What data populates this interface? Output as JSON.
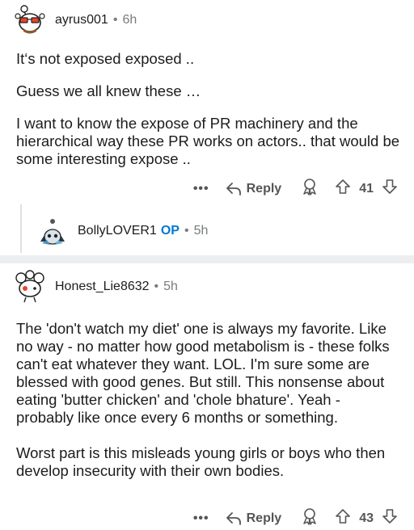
{
  "comments": [
    {
      "username": "ayrus001",
      "time": "6h",
      "paragraphs": [
        "It‘s not exposed exposed ..",
        "Guess we all knew these …",
        "I want to know the expose of PR machinery and the hierarchical way these PR works on actors.. that would be some interesting expose .."
      ],
      "more": "•••",
      "reply_label": "Reply",
      "score": "41"
    },
    {
      "username": "Honest_Lie8632",
      "time": "5h",
      "paragraphs": [
        "The 'don't watch my diet' one is always my favorite. Like no way - no matter how good metabolism is - these folks can't eat whatever they want. LOL. I'm sure some are blessed with good genes. But still. This nonsense about eating 'butter chicken' and 'chole bhature'.  Yeah - probably like once every 6 months or something.",
        "Worst part is this misleads young girls or boys who then develop insecurity with their own bodies."
      ],
      "more": "•••",
      "reply_label": "Reply",
      "score": "43"
    }
  ],
  "reply": {
    "username": "BollyLOVER1",
    "op_badge": "OP",
    "time": "5h"
  },
  "separator": "•",
  "colors": {
    "op": "#0079d3",
    "meta": "#787c7e",
    "divider": "#eceeef"
  },
  "icons": [
    "snoo-avatar-icon",
    "reply-arrow-icon",
    "award-icon",
    "upvote-icon",
    "downvote-icon"
  ]
}
